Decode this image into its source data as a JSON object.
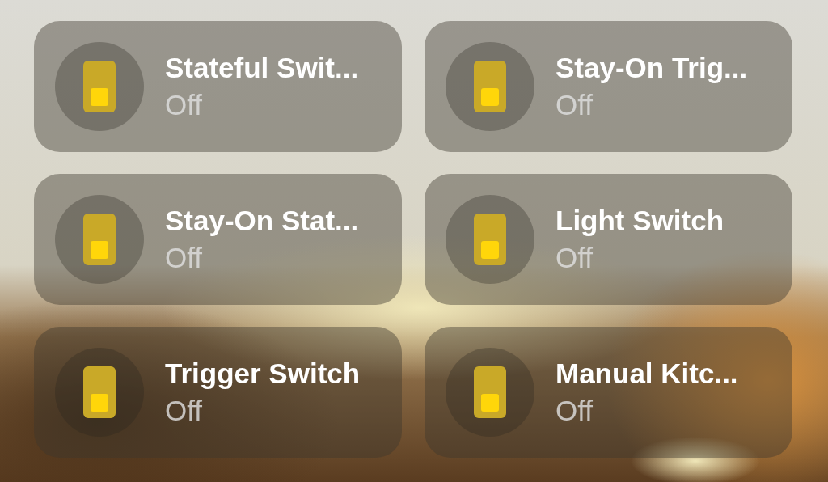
{
  "tiles": [
    {
      "name": "Stateful Swit...",
      "status": "Off",
      "on": false
    },
    {
      "name": "Stay-On Trig...",
      "status": "Off",
      "on": false
    },
    {
      "name": "Stay-On Stat...",
      "status": "Off",
      "on": false
    },
    {
      "name": "Light Switch",
      "status": "Off",
      "on": false
    },
    {
      "name": "Trigger Switch",
      "status": "Off",
      "on": false
    },
    {
      "name": "Manual Kitc...",
      "status": "Off",
      "on": false
    }
  ]
}
